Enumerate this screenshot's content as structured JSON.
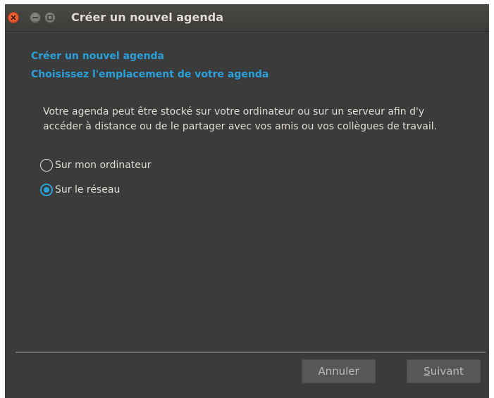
{
  "window": {
    "title": "Créer un nouvel agenda"
  },
  "wizard": {
    "heading": "Créer un nouvel agenda",
    "subheading": "Choisissez l'emplacement de votre agenda",
    "description": "Votre agenda peut être stocké sur votre ordinateur ou sur un serveur afin d'y accéder à distance ou de le partager avec vos amis ou vos collègues de travail.",
    "options": [
      {
        "label": "Sur mon ordinateur",
        "selected": false
      },
      {
        "label": "Sur le réseau",
        "selected": true
      }
    ]
  },
  "buttons": {
    "cancel_label": "Annuler",
    "next_mnemonic": "S",
    "next_rest": "uivant"
  },
  "colors": {
    "accent": "#2a9fd8",
    "background": "#3c3c3c",
    "close": "#df4a1a"
  }
}
